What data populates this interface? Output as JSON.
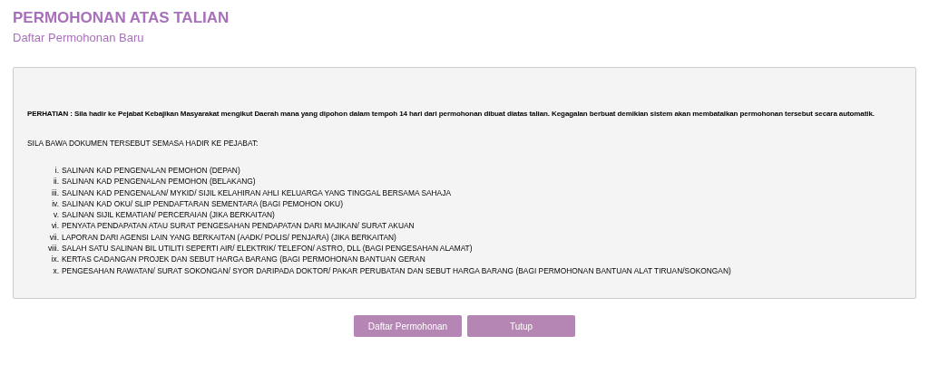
{
  "title": "PERMOHONAN ATAS TALIAN",
  "subtitle": "Daftar Permohonan Baru",
  "notice": {
    "warning": "PERHATIAN : Sila hadir ke Pejabat Kebajikan Masyarakat mengikut Daerah mana yang dipohon dalam tempoh 14 hari dari permohonan dibuat diatas talian. Kegagalan berbuat demikian sistem akan membatalkan permohonan tersebut secara automatik.",
    "instruction": "SILA BAWA DOKUMEN TERSEBUT SEMASA HADIR KE PEJABAT:",
    "documents": [
      {
        "marker": "i.",
        "text": "SALINAN KAD PENGENALAN PEMOHON (DEPAN)"
      },
      {
        "marker": "ii.",
        "text": "SALINAN KAD PENGENALAN PEMOHON (BELAKANG)"
      },
      {
        "marker": "iii.",
        "text": "SALINAN KAD PENGENALAN/ MYKID/ SIJIL KELAHIRAN AHLI KELUARGA YANG TINGGAL BERSAMA SAHAJA"
      },
      {
        "marker": "iv.",
        "text": "SALINAN KAD OKU/ SLIP PENDAFTARAN SEMENTARA (BAGI PEMOHON OKU)"
      },
      {
        "marker": "v.",
        "text": "SALINAN SIJIL KEMATIAN/ PERCERAIAN (JIKA BERKAITAN)"
      },
      {
        "marker": "vi.",
        "text": "PENYATA PENDAPATAN ATAU SURAT PENGESAHAN PENDAPATAN DARI MAJIKAN/ SURAT AKUAN"
      },
      {
        "marker": "vii.",
        "text": "LAPORAN DARI AGENSI LAIN YANG BERKAITAN (AADK/ POLIS/ PENJARA) (JIKA BERKAITAN)"
      },
      {
        "marker": "viii.",
        "text": "SALAH SATU SALINAN BIL UTILITI SEPERTI AIR/ ELEKTRIK/ TELEFON/ ASTRO, DLL (BAGI PENGESAHAN ALAMAT)"
      },
      {
        "marker": "ix.",
        "text": "KERTAS CADANGAN PROJEK DAN SEBUT HARGA BARANG (BAGI PERMOHONAN BANTUAN GERAN"
      },
      {
        "marker": "x.",
        "text": "PENGESAHAN RAWATAN/ SURAT SOKONGAN/ SYOR DARIPADA DOKTOR/ PAKAR PERUBATAN DAN SEBUT HARGA BARANG (BAGI PERMOHONAN BANTUAN ALAT TIRUAN/SOKONGAN)"
      }
    ]
  },
  "buttons": [
    "Daftar Permohonan",
    "Tutup"
  ]
}
